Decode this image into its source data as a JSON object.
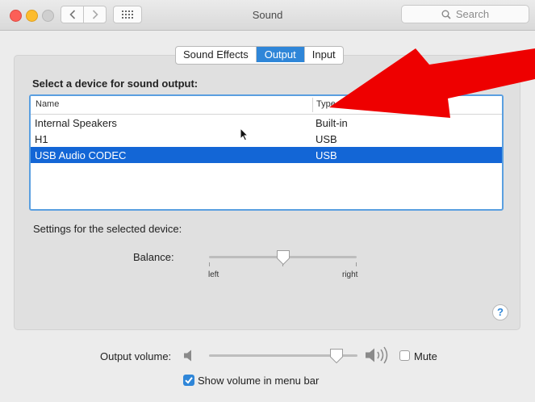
{
  "window": {
    "title": "Sound"
  },
  "search": {
    "placeholder": "Search"
  },
  "tabs": [
    {
      "label": "Sound Effects",
      "active": false
    },
    {
      "label": "Output",
      "active": true
    },
    {
      "label": "Input",
      "active": false
    }
  ],
  "output": {
    "section_label": "Select a device for sound output:",
    "columns": [
      "Name",
      "Type"
    ],
    "devices": [
      {
        "name": "Internal Speakers",
        "type": "Built-in",
        "selected": false
      },
      {
        "name": "H1",
        "type": "USB",
        "selected": false
      },
      {
        "name": "USB Audio CODEC",
        "type": "USB",
        "selected": true
      }
    ]
  },
  "settings": {
    "label": "Settings for the selected device:",
    "balance": {
      "label": "Balance:",
      "left_label": "left",
      "right_label": "right",
      "value": 0.5
    }
  },
  "volume": {
    "label": "Output volume:",
    "value": 0.86,
    "mute_label": "Mute",
    "mute_checked": false,
    "show_in_menu_bar_label": "Show volume in menu bar",
    "show_in_menu_bar_checked": true
  },
  "colors": {
    "accent": "#1366d6",
    "arrow": "#ee0000"
  }
}
